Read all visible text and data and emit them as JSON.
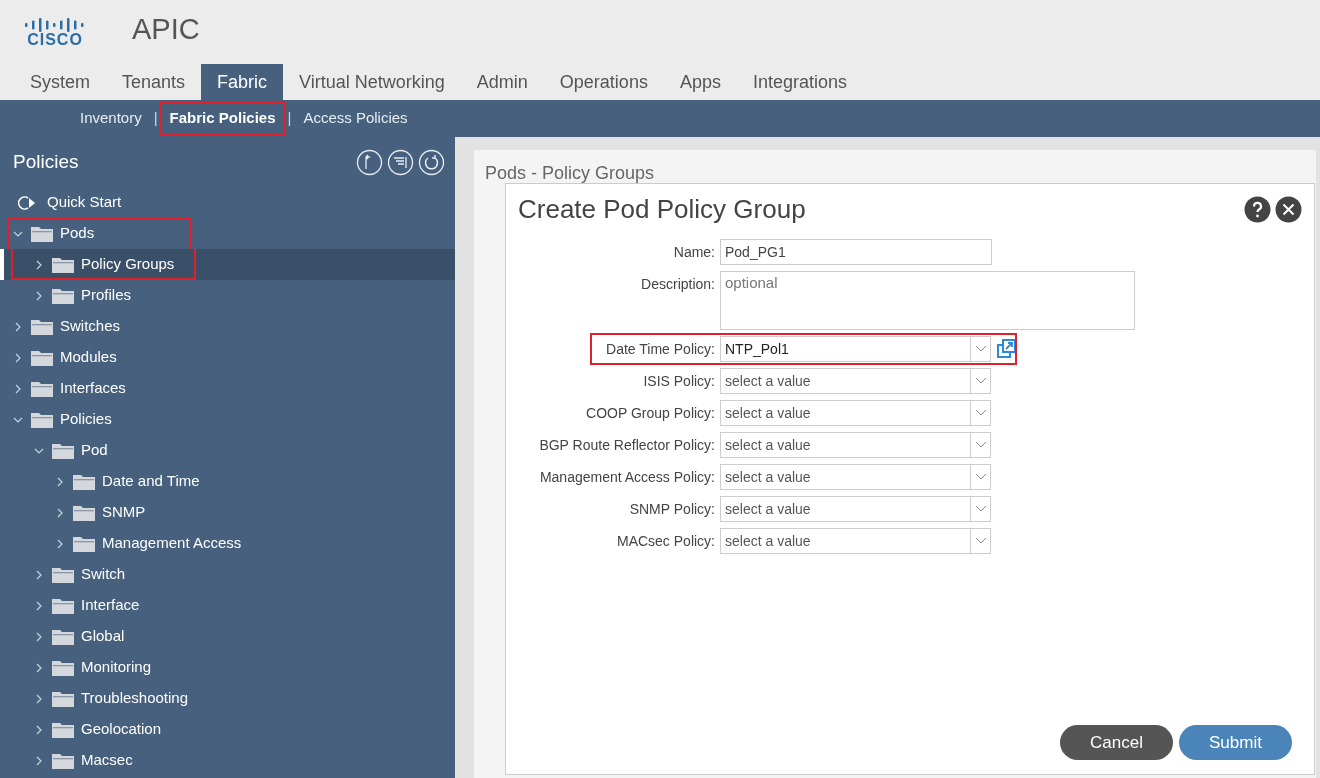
{
  "app": {
    "logo": "CISCO",
    "title": "APIC"
  },
  "tabs": [
    {
      "label": "System",
      "selected": false
    },
    {
      "label": "Tenants",
      "selected": false
    },
    {
      "label": "Fabric",
      "selected": true
    },
    {
      "label": "Virtual Networking",
      "selected": false
    },
    {
      "label": "Admin",
      "selected": false
    },
    {
      "label": "Operations",
      "selected": false
    },
    {
      "label": "Apps",
      "selected": false
    },
    {
      "label": "Integrations",
      "selected": false
    }
  ],
  "subtab_separator": "|",
  "subtabs": [
    {
      "label": "Inventory",
      "selected": false,
      "highlighted": false
    },
    {
      "label": "Fabric Policies",
      "selected": true,
      "highlighted": true
    },
    {
      "label": "Access Policies",
      "selected": false,
      "highlighted": false
    }
  ],
  "sidebar": {
    "title": "Policies",
    "items": [
      {
        "label": "Quick Start",
        "kind": "start",
        "selected": false,
        "highlighted": false
      },
      {
        "label": "Pods",
        "kind": "folder",
        "expanded": true,
        "selected": false,
        "highlighted": true,
        "children": [
          {
            "label": "Policy Groups",
            "kind": "folder",
            "expanded": false,
            "selected": true,
            "highlighted": true
          },
          {
            "label": "Profiles",
            "kind": "folder",
            "expanded": false,
            "selected": false,
            "highlighted": false
          }
        ]
      },
      {
        "label": "Switches",
        "kind": "folder",
        "expanded": false,
        "selected": false,
        "highlighted": false
      },
      {
        "label": "Modules",
        "kind": "folder",
        "expanded": false,
        "selected": false,
        "highlighted": false
      },
      {
        "label": "Interfaces",
        "kind": "folder",
        "expanded": false,
        "selected": false,
        "highlighted": false
      },
      {
        "label": "Policies",
        "kind": "folder",
        "expanded": true,
        "selected": false,
        "highlighted": false,
        "children": [
          {
            "label": "Pod",
            "kind": "folder",
            "expanded": true,
            "selected": false,
            "highlighted": false,
            "children": [
              {
                "label": "Date and Time",
                "kind": "folder",
                "expanded": false,
                "selected": false,
                "highlighted": false
              },
              {
                "label": "SNMP",
                "kind": "folder",
                "expanded": false,
                "selected": false,
                "highlighted": false
              },
              {
                "label": "Management Access",
                "kind": "folder",
                "expanded": false,
                "selected": false,
                "highlighted": false
              }
            ]
          },
          {
            "label": "Switch",
            "kind": "folder",
            "expanded": false,
            "selected": false,
            "highlighted": false
          },
          {
            "label": "Interface",
            "kind": "folder",
            "expanded": false,
            "selected": false,
            "highlighted": false
          },
          {
            "label": "Global",
            "kind": "folder",
            "expanded": false,
            "selected": false,
            "highlighted": false
          },
          {
            "label": "Monitoring",
            "kind": "folder",
            "expanded": false,
            "selected": false,
            "highlighted": false
          },
          {
            "label": "Troubleshooting",
            "kind": "folder",
            "expanded": false,
            "selected": false,
            "highlighted": false
          },
          {
            "label": "Geolocation",
            "kind": "folder",
            "expanded": false,
            "selected": false,
            "highlighted": false
          },
          {
            "label": "Macsec",
            "kind": "folder",
            "expanded": false,
            "selected": false,
            "highlighted": false
          }
        ]
      }
    ]
  },
  "page": {
    "title": "Pods - Policy Groups"
  },
  "dialog": {
    "title": "Create Pod Policy Group",
    "fields": [
      {
        "label": "Name:",
        "kind": "text",
        "value": "Pod_PG1",
        "highlighted": false
      },
      {
        "label": "Description:",
        "kind": "textarea",
        "placeholder": "optional",
        "highlighted": false
      },
      {
        "label": "Date Time Policy:",
        "kind": "select",
        "value": "NTP_Pol1",
        "link": true,
        "highlighted": true
      },
      {
        "label": "ISIS Policy:",
        "kind": "select",
        "placeholder": "select a value",
        "link": false,
        "highlighted": false
      },
      {
        "label": "COOP Group Policy:",
        "kind": "select",
        "placeholder": "select a value",
        "link": false,
        "highlighted": false
      },
      {
        "label": "BGP Route Reflector Policy:",
        "kind": "select",
        "placeholder": "select a value",
        "link": false,
        "highlighted": false
      },
      {
        "label": "Management Access Policy:",
        "kind": "select",
        "placeholder": "select a value",
        "link": false,
        "highlighted": false
      },
      {
        "label": "SNMP Policy:",
        "kind": "select",
        "placeholder": "select a value",
        "link": false,
        "highlighted": false
      },
      {
        "label": "MACsec Policy:",
        "kind": "select",
        "placeholder": "select a value",
        "link": false,
        "highlighted": false
      }
    ],
    "buttons": [
      {
        "label": "Cancel",
        "kind": "secondary"
      },
      {
        "label": "Submit",
        "kind": "primary"
      }
    ]
  }
}
